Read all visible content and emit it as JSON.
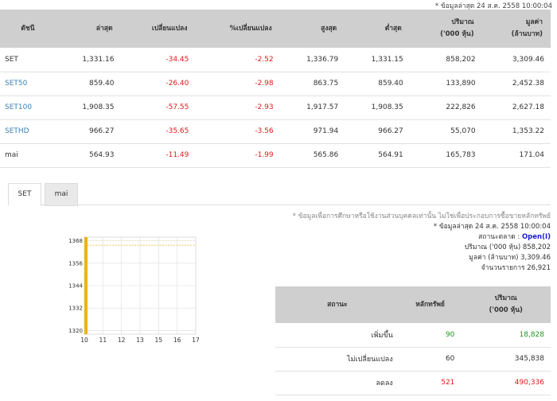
{
  "header_note": "* ข้อมูลล่าสุด 24 ส.ค. 2558 10:00:04",
  "index_table": {
    "columns": [
      "ดัชนี",
      "ล่าสุด",
      "เปลี่ยนแปลง",
      "%เปลี่ยนแปลง",
      "สูงสุด",
      "ต่ำสุด",
      "ปริมาณ\n('000 หุ้น)",
      "มูลค่า\n(ล้านบาท)"
    ],
    "rows": [
      [
        "SET",
        "1,331.16",
        "-34.45",
        "-2.52",
        "1,336.79",
        "1,331.15",
        "858,202",
        "3,309.46"
      ],
      [
        "SET50",
        "859.40",
        "-26.40",
        "-2.98",
        "863.75",
        "859.40",
        "133,890",
        "2,452.38"
      ],
      [
        "SET100",
        "1,908.35",
        "-57.55",
        "-2.93",
        "1,917.57",
        "1,908.35",
        "222,826",
        "2,627.18"
      ],
      [
        "SETHD",
        "966.27",
        "-35.65",
        "-3.56",
        "971.94",
        "966.27",
        "55,070",
        "1,353.22"
      ],
      [
        "mai",
        "564.93",
        "-11.49",
        "-1.99",
        "565.86",
        "564.91",
        "165,783",
        "171.04"
      ]
    ]
  },
  "tabs": [
    "SET",
    "mai"
  ],
  "chart_data": {
    "type": "bar",
    "x_ticks": [
      "10",
      "11",
      "12",
      "13",
      "15",
      "16",
      "17"
    ],
    "y_ticks": [
      "1368",
      "1356",
      "1344",
      "1332",
      "1320"
    ],
    "ylim": [
      1318,
      1370
    ],
    "reference_line": 1365.61,
    "bar": {
      "x": "10",
      "value": 1331.16
    },
    "grid": true,
    "colors": {
      "bar": "#f0b21a",
      "reference": "#e3c85a",
      "grid": "#dddddd"
    }
  },
  "info": {
    "disclaimer": "* ข้อมูลเพื่อการศึกษาหรือใช้งานส่วนบุคคลเท่านั้น ไม่ใช่เพื่อประกอบการซื้อขายหลักทรัพย์",
    "updated": "* ข้อมูลล่าสุด 24 ส.ค. 2558 10:00:04",
    "status_label": "สถานะตลาด :",
    "status_value": "Open(I)",
    "volume_label": "ปริมาณ ('000 หุ้น)",
    "volume_value": "858,202",
    "value_label": "มูลค่า (ล้านบาท)",
    "value_value": "3,309.46",
    "deals_label": "จำนวนรายการ",
    "deals_value": "26,921"
  },
  "adv_table": {
    "columns": [
      "สถานะ",
      "หลักทรัพย์",
      "ปริมาณ\n('000 หุ้น)"
    ],
    "rows": [
      [
        "เพิ่มขึ้น",
        "90",
        "18,828"
      ],
      [
        "ไม่เปลี่ยนแปลง",
        "60",
        "345,838"
      ],
      [
        "ลดลง",
        "521",
        "490,336"
      ]
    ]
  }
}
